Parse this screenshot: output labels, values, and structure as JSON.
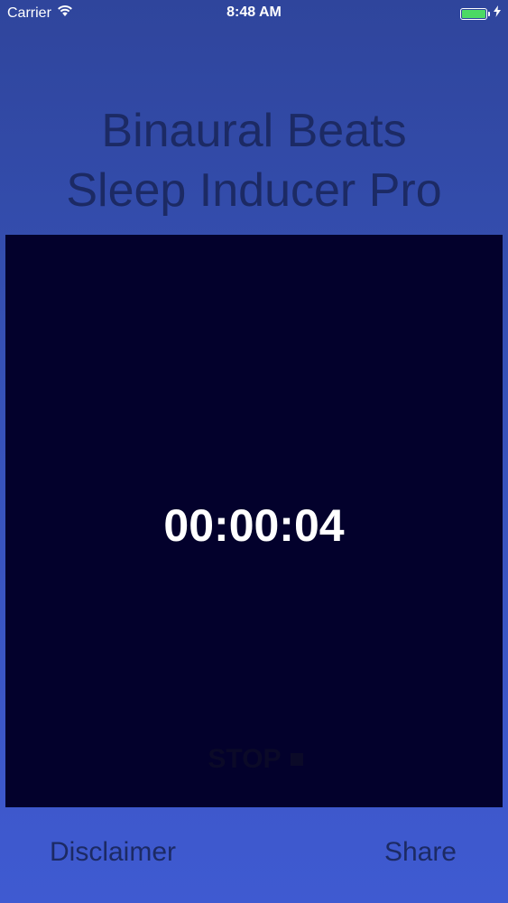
{
  "status_bar": {
    "carrier": "Carrier",
    "time": "8:48 AM",
    "battery_color": "#4cd964"
  },
  "app": {
    "title_line1": "Binaural Beats",
    "title_line2": "Sleep Inducer Pro"
  },
  "player": {
    "timer": "00:00:04",
    "stop_label": "STOP",
    "stop_icon": "stop-square-icon"
  },
  "footer": {
    "disclaimer_label": "Disclaimer",
    "share_label": "Share"
  },
  "colors": {
    "background_top": "#2f459c",
    "background_bottom": "#3f5ad1",
    "panel": "#03012c",
    "title_text": "#1c2a64",
    "timer_text": "#ffffff"
  }
}
